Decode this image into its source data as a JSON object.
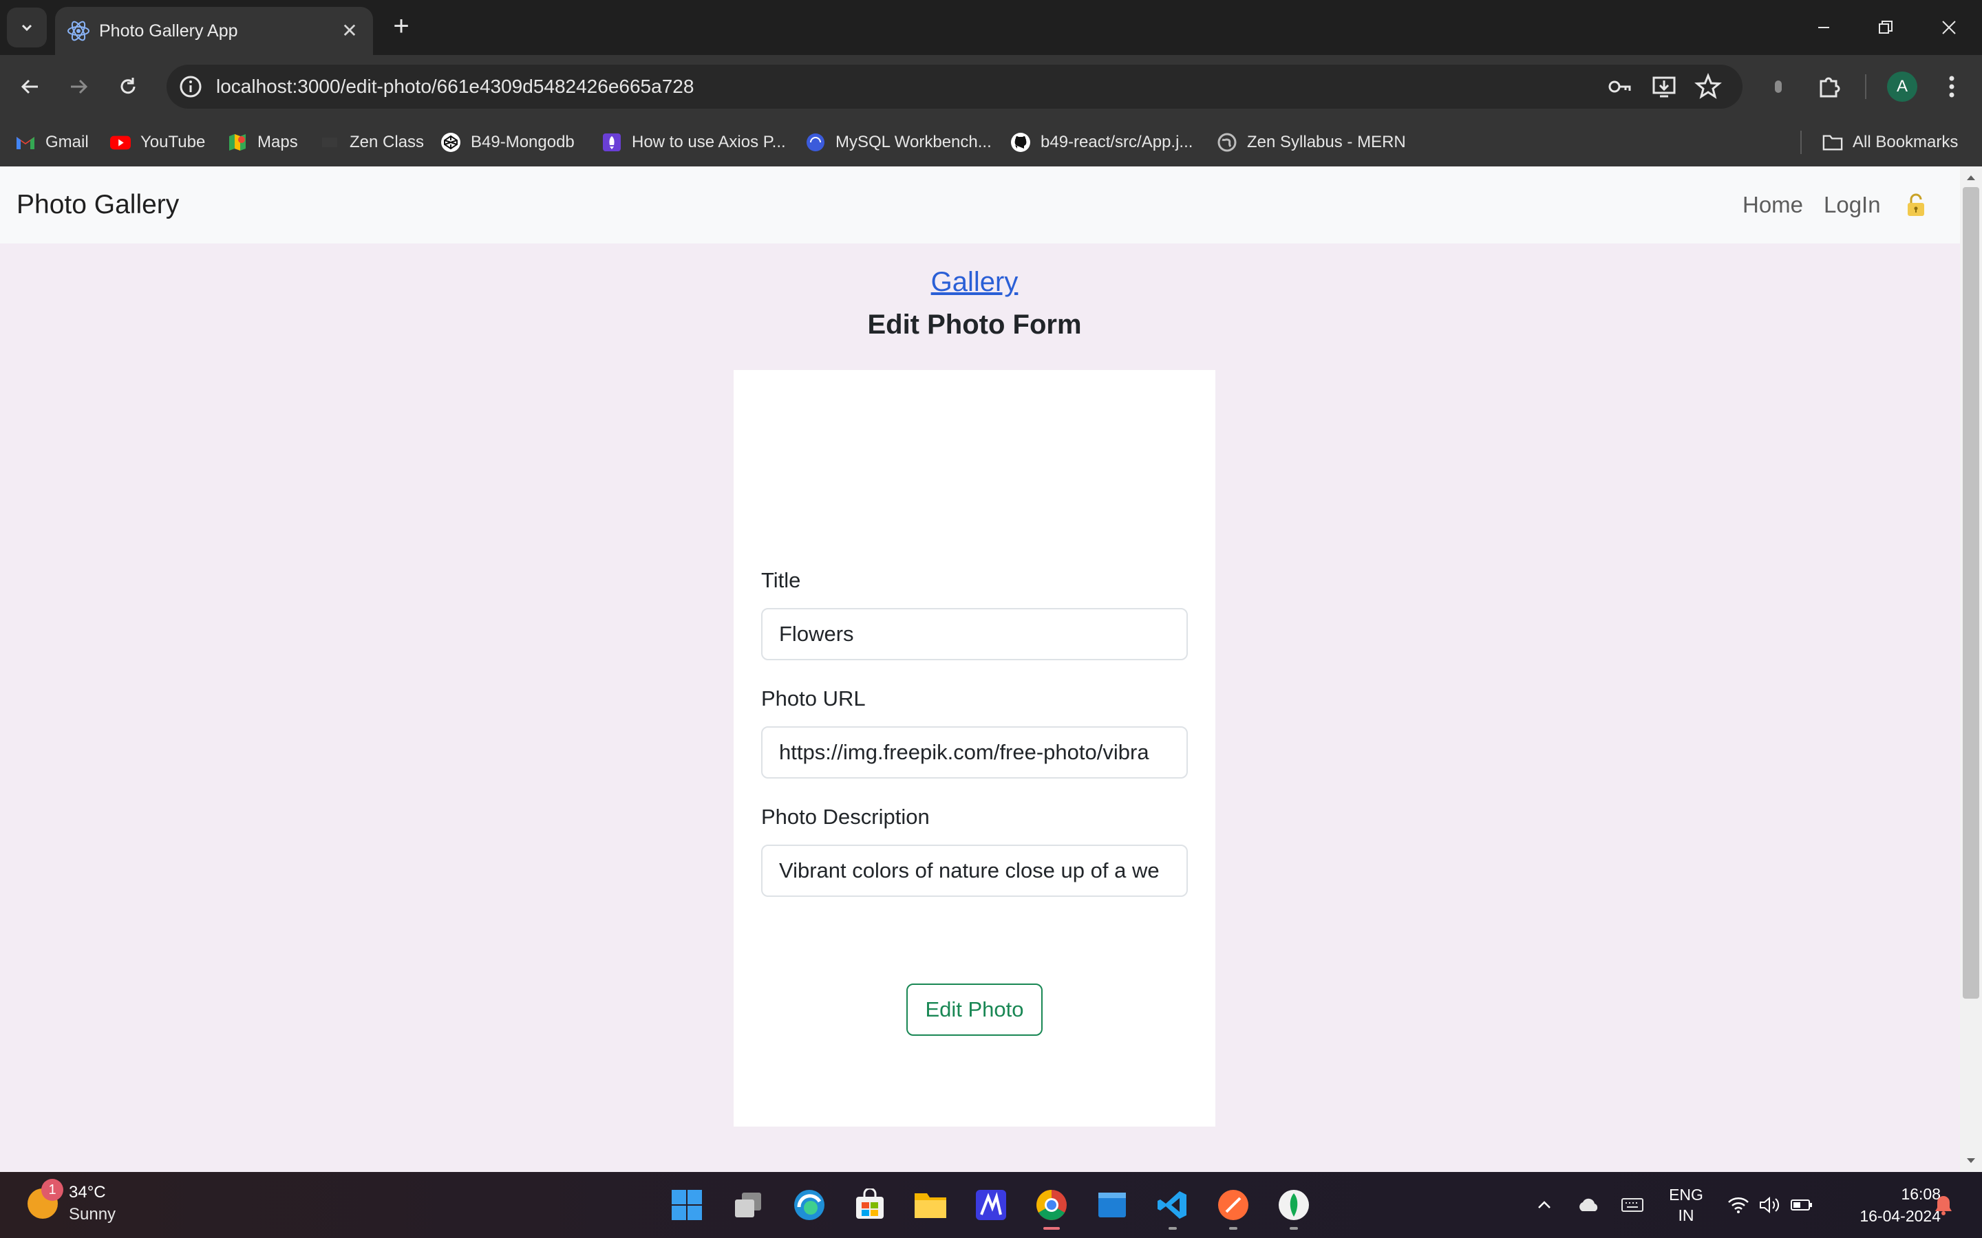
{
  "browser": {
    "tab_title": "Photo Gallery App",
    "url": "localhost:3000/edit-photo/661e4309d5482426e665a728",
    "bookmarks": [
      {
        "label": "Gmail",
        "icon": "gmail-icon"
      },
      {
        "label": "YouTube",
        "icon": "youtube-icon"
      },
      {
        "label": "Maps",
        "icon": "maps-icon"
      },
      {
        "label": "Zen Class",
        "icon": "zen-class-icon"
      },
      {
        "label": "B49-Mongodb",
        "icon": "codepen-icon"
      },
      {
        "label": "How to use Axios P...",
        "icon": "rocket-icon"
      },
      {
        "label": "MySQL Workbench...",
        "icon": "globe-blue-icon"
      },
      {
        "label": "b49-react/src/App.j...",
        "icon": "github-icon"
      },
      {
        "label": "Zen Syllabus - MERN",
        "icon": "globe-icon"
      }
    ],
    "all_bookmarks_label": "All Bookmarks",
    "profile_initial": "A"
  },
  "navbar": {
    "brand": "Photo Gallery",
    "links": [
      "Home",
      "LogIn"
    ]
  },
  "page": {
    "gallery_link": "Gallery",
    "heading": "Edit Photo Form"
  },
  "form": {
    "title_label": "Title",
    "title_value": "Flowers",
    "url_label": "Photo URL",
    "url_value": "https://img.freepik.com/free-photo/vibra",
    "description_label": "Photo Description",
    "description_value": "Vibrant colors of nature close up of a we",
    "submit_label": "Edit Photo"
  },
  "taskbar": {
    "weather_badge": "1",
    "weather_temp": "34°C",
    "weather_condition": "Sunny",
    "lang_line1": "ENG",
    "lang_line2": "IN",
    "time": "16:08",
    "date": "16-04-2024"
  },
  "colors": {
    "page_background": "#f3ecf4",
    "link": "#2a5fd6",
    "button_outline": "#198754"
  }
}
